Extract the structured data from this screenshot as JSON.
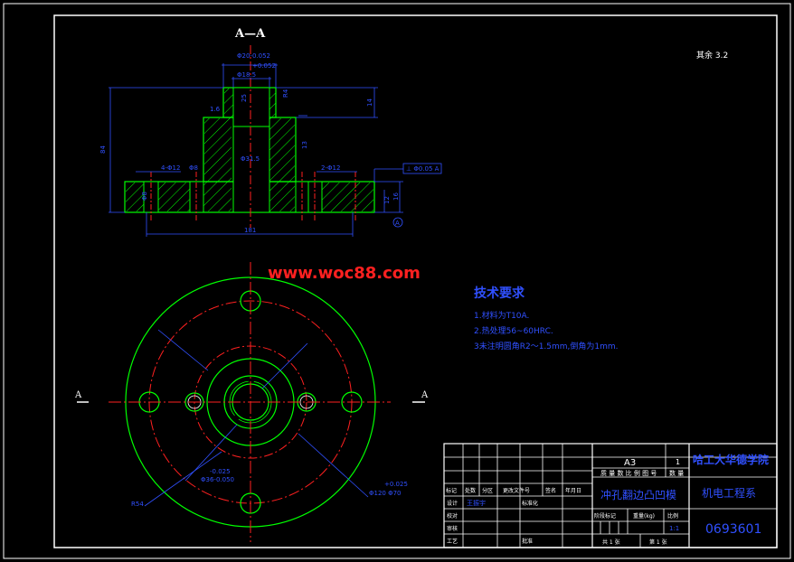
{
  "section_title": "A—A",
  "roughness_note": "其余 3.2",
  "website": "www.woc88.com",
  "view_markers": {
    "left": "A",
    "right": "A"
  },
  "section_dims": {
    "bore_top": "Φ20-0.052",
    "tol_top": "+0.052",
    "bore_mid": "Φ18.5",
    "bore_lower": "Φ31.5",
    "length_left": "84",
    "height_right": "14",
    "height_inner": "13",
    "small_a": "1.6",
    "small_b": "25",
    "small_c": "R4",
    "left_hole": "4-Φ12",
    "right_hole": "2-Φ12",
    "left_sub": "Φ8",
    "right_sub": "Φ8",
    "gdt": "⊥ Φ0.05 A",
    "flange_h": "16",
    "flange_h2": "12",
    "datum": "A",
    "total_width": "181"
  },
  "plan_dims": {
    "left_bottom": "R54",
    "mid_left_tol": "-0.025",
    "mid_left": "Φ36-0.050",
    "right_tol": "+0.025",
    "right_main": "Φ120 Φ70"
  },
  "tech_req": {
    "title": "技术要求",
    "items": [
      "1.材料为T10A.",
      "2.热处理56~60HRC.",
      "3未注明圆角R2～1.5mm,倒角为1mm."
    ]
  },
  "title_block": {
    "paper": "A3",
    "paper_no": "1",
    "header_row": "质 量 数 比 例 图 号",
    "quantity": "数 量",
    "school": "哈工大华德学院",
    "part_name": "冲孔翻边凸凹模",
    "dept": "机电工程系",
    "drawing_no": "0693601",
    "row_labels": [
      "标记",
      "处数",
      "分区",
      "更改文件号",
      "签名",
      "年月日"
    ],
    "design_label": "设计",
    "designer": "王振宇",
    "standard_label": "标准化",
    "check_label": "校对",
    "review_label": "审核",
    "craft_label": "工艺",
    "approve_label": "批准",
    "stage_label": "阶段标记",
    "weight_label": "重量(kg)",
    "scale_label": "比例",
    "scale_value": "1:1",
    "total_sheets": "共 1 张",
    "sheet_no": "第 1 张"
  }
}
